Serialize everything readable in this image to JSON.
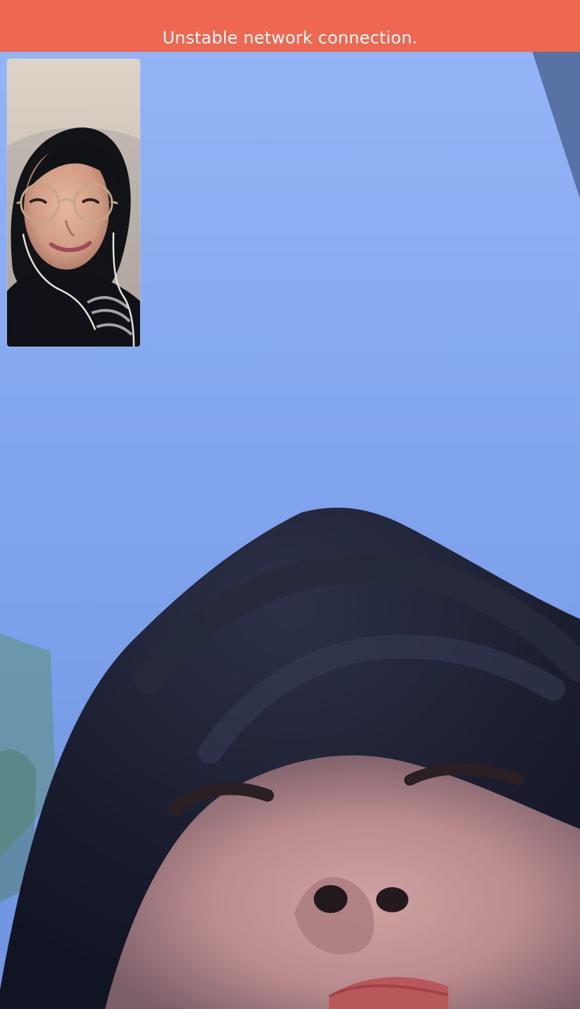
{
  "call": {
    "network_warning": "Unstable network connection."
  },
  "colors": {
    "banner": "#ee6750",
    "banner_text": "#ffffff",
    "sky": "#7fa6ec"
  },
  "icons": {
    "remote_video": "remote-video-feed",
    "self_preview": "self-camera-preview"
  }
}
